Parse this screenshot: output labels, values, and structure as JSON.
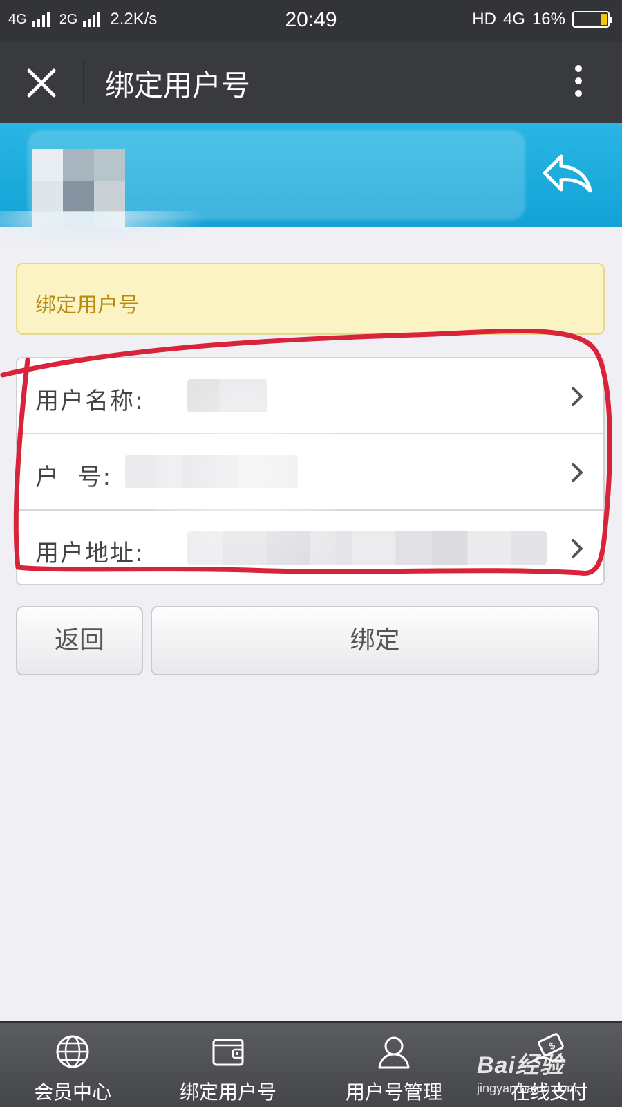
{
  "status_bar": {
    "network1": "4G",
    "network2": "2G",
    "speed": "2.2K/s",
    "time": "20:49",
    "hd": "HD",
    "network3": "4G",
    "battery": "16%",
    "battery_color": "#f7c600"
  },
  "nav": {
    "title": "绑定用户号",
    "close_icon": "close-icon",
    "more_icon": "more-vertical-icon"
  },
  "banner": {
    "back_icon": "reply-arrow-icon",
    "bg_color": "#1aa8db"
  },
  "notice": {
    "text": "绑定用户号"
  },
  "form": {
    "rows": [
      {
        "label": "用户名称:"
      },
      {
        "label": "户  号:"
      },
      {
        "label": "用户地址:"
      }
    ]
  },
  "buttons": {
    "back": "返回",
    "bind": "绑定"
  },
  "tabs": [
    {
      "label": "会员中心",
      "icon": "globe-icon"
    },
    {
      "label": "绑定用户号",
      "icon": "wallet-icon"
    },
    {
      "label": "用户号管理",
      "icon": "user-icon"
    },
    {
      "label": "在线支付",
      "icon": "payment-icon"
    }
  ],
  "watermark": {
    "main": "Bai经验",
    "sub": "jingyan.baidu.com"
  },
  "annotation_color": "#d8233a"
}
